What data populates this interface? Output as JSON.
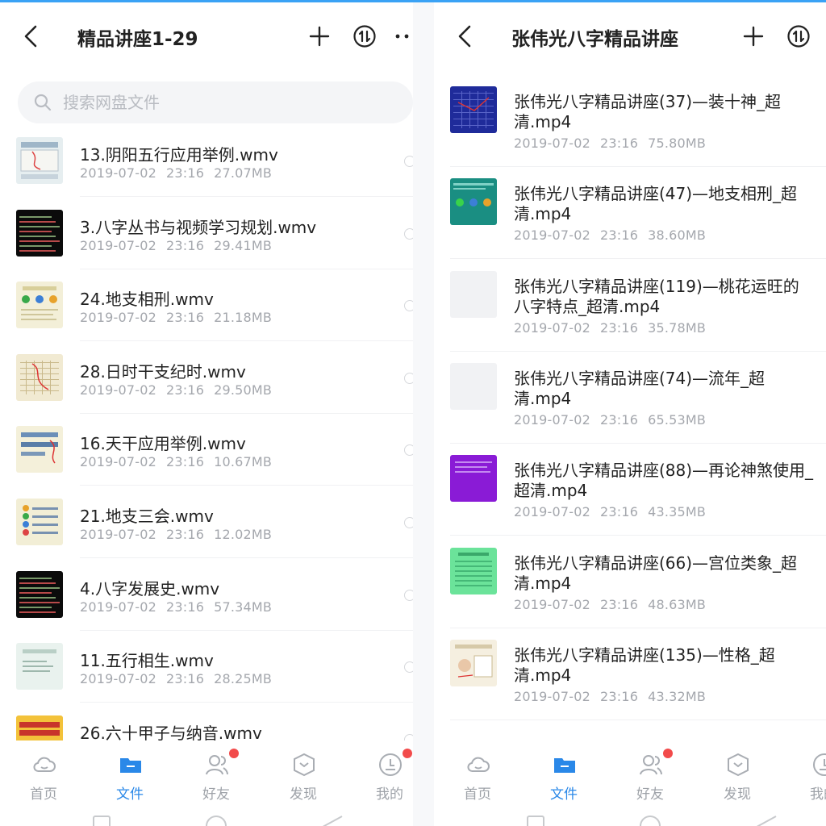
{
  "left": {
    "title": "精品讲座1-29",
    "search_placeholder": "搜索网盘文件",
    "files": [
      {
        "name": "13.阴阳五行应用举例.wmv",
        "date": "2019-07-02",
        "time": "23:16",
        "size": "27.07MB",
        "thumb": "diagram-light"
      },
      {
        "name": "3.八字丛书与视频学习规划.wmv",
        "date": "2019-07-02",
        "time": "23:16",
        "size": "29.41MB",
        "thumb": "dark-text"
      },
      {
        "name": "24.地支相刑.wmv",
        "date": "2019-07-02",
        "time": "23:16",
        "size": "21.18MB",
        "thumb": "balls-cream"
      },
      {
        "name": "28.日时干支纪时.wmv",
        "date": "2019-07-02",
        "time": "23:16",
        "size": "29.50MB",
        "thumb": "table-cream"
      },
      {
        "name": "16.天干应用举例.wmv",
        "date": "2019-07-02",
        "time": "23:16",
        "size": "10.67MB",
        "thumb": "diagram-cream"
      },
      {
        "name": "21.地支三会.wmv",
        "date": "2019-07-02",
        "time": "23:16",
        "size": "12.02MB",
        "thumb": "balls-list"
      },
      {
        "name": "4.八字发展史.wmv",
        "date": "2019-07-02",
        "time": "23:16",
        "size": "57.34MB",
        "thumb": "dark-text"
      },
      {
        "name": "11.五行相生.wmv",
        "date": "2019-07-02",
        "time": "23:16",
        "size": "28.25MB",
        "thumb": "pale-green"
      },
      {
        "name": "26.六十甲子与纳音.wmv",
        "date": "",
        "time": "",
        "size": "",
        "thumb": "red-grid"
      }
    ]
  },
  "right": {
    "title": "张伟光八字精品讲座",
    "files": [
      {
        "line1": "张伟光八字精品讲座(37)—装十神_超",
        "line2": "清.mp4",
        "date": "2019-07-02",
        "time": "23:16",
        "size": "75.80MB",
        "thumb": "blue-grid"
      },
      {
        "line1": "张伟光八字精品讲座(47)—地支相刑_超",
        "line2": "清.mp4",
        "date": "2019-07-02",
        "time": "23:16",
        "size": "38.60MB",
        "thumb": "teal-balls"
      },
      {
        "line1": "张伟光八字精品讲座(119)—桃花运旺的",
        "line2": "八字特点_超清.mp4",
        "date": "2019-07-02",
        "time": "23:16",
        "size": "35.78MB",
        "thumb": "blank"
      },
      {
        "line1": "张伟光八字精品讲座(74)—流年_超",
        "line2": "清.mp4",
        "date": "2019-07-02",
        "time": "23:16",
        "size": "65.53MB",
        "thumb": "blank"
      },
      {
        "line1": "张伟光八字精品讲座(88)—再论神煞使用_",
        "line2": "超清.mp4",
        "date": "2019-07-02",
        "time": "23:16",
        "size": "43.35MB",
        "thumb": "purple"
      },
      {
        "line1": "张伟光八字精品讲座(66)—宫位类象_超",
        "line2": "清.mp4",
        "date": "2019-07-02",
        "time": "23:16",
        "size": "48.63MB",
        "thumb": "green"
      },
      {
        "line1": "张伟光八字精品讲座(135)—性格_超",
        "line2": "清.mp4",
        "date": "2019-07-02",
        "time": "23:16",
        "size": "43.32MB",
        "thumb": "drawing"
      }
    ]
  },
  "tabs": [
    {
      "label": "首页",
      "icon": "cloud-icon",
      "active": false,
      "badge": false
    },
    {
      "label": "文件",
      "icon": "folder-icon",
      "active": true,
      "badge": false
    },
    {
      "label": "好友",
      "icon": "friends-icon",
      "active": false,
      "badge": true
    },
    {
      "label": "发现",
      "icon": "discover-icon",
      "active": false,
      "badge": false
    },
    {
      "label": "我的",
      "icon": "me-icon",
      "active": false,
      "badge": true
    }
  ],
  "right_tabs": [
    {
      "label": "首页"
    },
    {
      "label": "文件"
    },
    {
      "label": "好友"
    },
    {
      "label": "发现"
    },
    {
      "label": "我的"
    }
  ],
  "colors": {
    "accent": "#2a88e8",
    "badge": "#f24b4b",
    "text": "#222222",
    "meta": "#a4a7ad"
  }
}
